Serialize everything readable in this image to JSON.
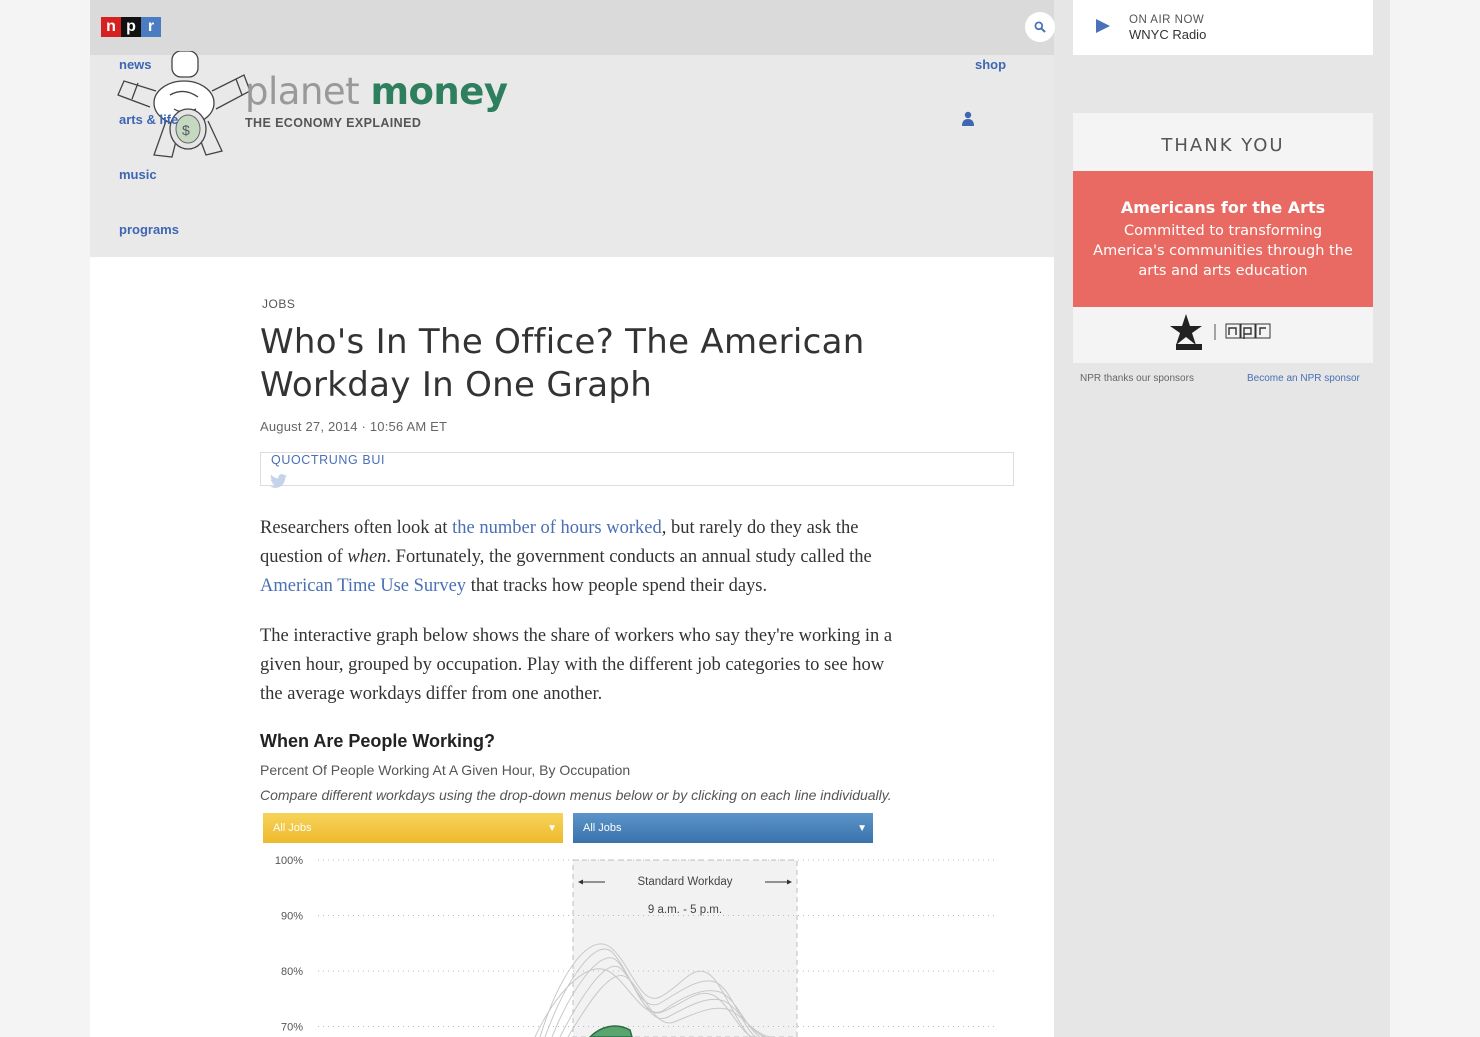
{
  "topbar": {
    "logo_letters": [
      "n",
      "p",
      "r"
    ],
    "search_icon": "search-icon"
  },
  "nav": {
    "items": [
      "news",
      "arts & life",
      "music",
      "programs"
    ],
    "shop": "shop"
  },
  "brand": {
    "word1": "planet",
    "word2": "money",
    "tagline": "THE ECONOMY EXPLAINED",
    "colors": {
      "word1": "#999999",
      "word2": "#2d7f5e"
    }
  },
  "article": {
    "slug": "JOBS",
    "headline": "Who's In The Office? The American Workday In One Graph",
    "dateline": "August 27, 2014 · 10:56 AM ET",
    "author": "QUOCTRUNG BUI",
    "p1": {
      "t1": "Researchers often look at ",
      "link1": "the number of hours worked",
      "t2": ", but rarely do they ask the question of ",
      "em": "when",
      "t3": ". Fortunately, the government conducts an annual study called the ",
      "link2": "American Time Use Survey",
      "t4": " that tracks how people spend their days."
    },
    "p2": "The interactive graph below shows the share of workers who say they're working in a given hour, grouped by occupation. Play with the different job categories to see how the average workdays differ from one another."
  },
  "graphic": {
    "title": "When Are People Working?",
    "subtitle": "Percent Of People Working At A Given Hour, By Occupation",
    "note": "Compare different workdays using the drop-down menus below or by clicking on each line individually.",
    "select1": {
      "value": "All Jobs",
      "color": "#f2c746"
    },
    "select2": {
      "value": "All Jobs",
      "color": "#4a85bc"
    },
    "band_label": "Standard Workday",
    "band_hours": "9 a.m. - 5 p.m."
  },
  "chart_data": {
    "type": "line",
    "yticks": [
      "100%",
      "90%",
      "80%",
      "70%"
    ],
    "ylim": [
      70,
      100
    ],
    "grid": true,
    "highlight_band": "9 a.m. - 5 p.m."
  },
  "sidebar": {
    "onair_label": "ON AIR NOW",
    "station": "WNYC Radio",
    "thank_you": "THANK YOU",
    "sponsor_name": "Americans for the Arts",
    "sponsor_desc": "Committed to transforming America's communities through the arts and arts education",
    "thanks_note": "NPR thanks our sponsors",
    "become_sponsor": "Become an NPR sponsor"
  }
}
